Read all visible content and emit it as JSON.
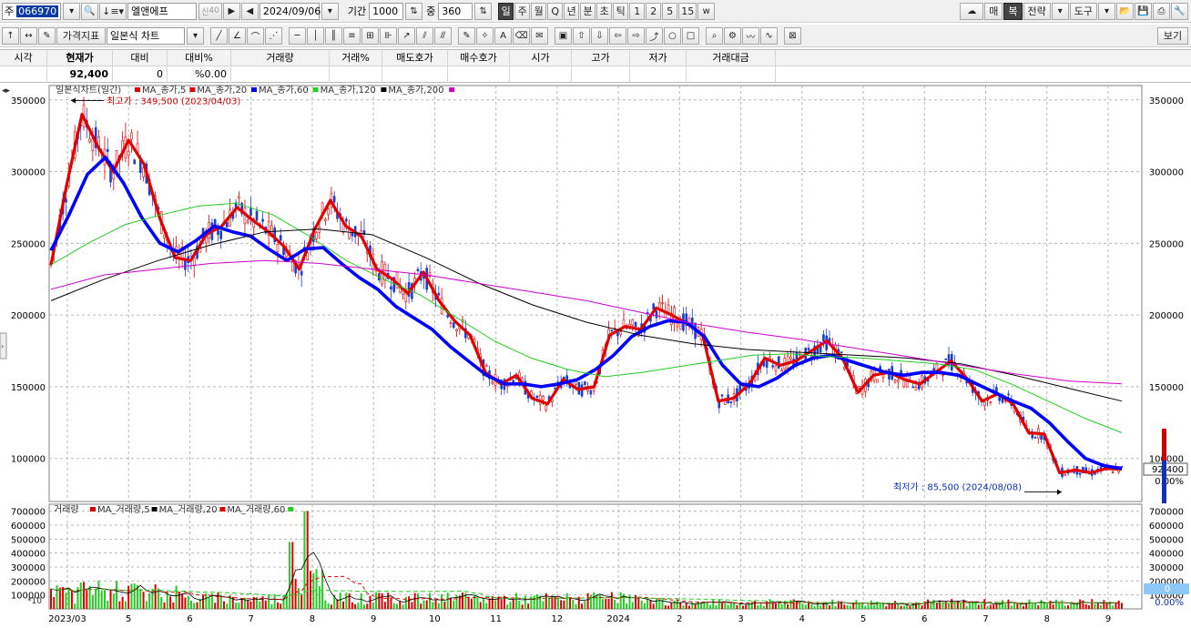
{
  "toolbar1": {
    "code_prefix": "주",
    "code": "066970",
    "stock_name": "엘앤에프",
    "badge_credit": "신",
    "badge_pct": "40",
    "date": "2024/09/06",
    "period_label": "기간",
    "period_value": "1000",
    "zoom_label": "중",
    "zoom_value": "360",
    "interval_buttons": [
      "일",
      "주",
      "월",
      "Q",
      "년",
      "분",
      "초",
      "틱",
      "1",
      "2",
      "5",
      "15"
    ],
    "right_buttons": [
      "매",
      "복",
      "전략",
      "도구"
    ]
  },
  "toolbar2": {
    "indicator_label": "가격지표",
    "chart_type": "일본식 차트",
    "view_button": "보기"
  },
  "quote": {
    "headers": [
      "시각",
      "현재가",
      "대비",
      "대비%",
      "거래량",
      "거래%",
      "매도호가",
      "매수호가",
      "시가",
      "고가",
      "저가",
      "거래대금"
    ],
    "values": [
      "",
      "92,400",
      "0",
      "%0.00",
      "",
      "",
      "",
      "",
      "",
      "",
      "",
      ""
    ]
  },
  "chart_data": [
    {
      "type": "candlestick",
      "title": "일본식차트(일간)",
      "legend": [
        {
          "name": "MA_종가,5",
          "color": "#e00000"
        },
        {
          "name": "MA_종가,20",
          "color": "#e00000"
        },
        {
          "name": "MA_종가,60",
          "color": "#0000ff"
        },
        {
          "name": "MA_종가,120",
          "color": "#22cc22"
        },
        {
          "name": "MA_종가,200",
          "color": "#000000"
        },
        {
          "name": "",
          "color": "#cc00cc"
        }
      ],
      "ylim": [
        70000,
        360000
      ],
      "y_ticks": [
        100000,
        150000,
        200000,
        250000,
        300000,
        350000
      ],
      "y_tick_labels": [
        "100000",
        "150000",
        "200000",
        "250000",
        "300000",
        "350000"
      ],
      "grid": true,
      "current_price_label": "92,400",
      "current_change_label": "0.00%",
      "annotations": [
        {
          "text": "최고가 : 349,500 (2023/04/03)",
          "value": 349500,
          "date": "2023/04/03"
        },
        {
          "text": "최저가 : 85,500 (2024/08/08)",
          "value": 85500,
          "date": "2024/08/08"
        }
      ],
      "x_labels": [
        "2023/03",
        "5",
        "6",
        "7",
        "8",
        "9",
        "10",
        "11",
        "12",
        "2024",
        "2",
        "3",
        "4",
        "5",
        "6",
        "7",
        "8",
        "9"
      ],
      "ma_series": [
        {
          "name": "MA_종가,5",
          "color": "#e00000",
          "values": [
            235000,
            290000,
            340000,
            318000,
            300000,
            322000,
            305000,
            268000,
            240000,
            238000,
            256000,
            262000,
            275000,
            266000,
            258000,
            248000,
            232000,
            260000,
            280000,
            262000,
            255000,
            232000,
            225000,
            215000,
            230000,
            210000,
            196000,
            186000,
            160000,
            152000,
            158000,
            142000,
            138000,
            155000,
            148000,
            150000,
            186000,
            192000,
            190000,
            205000,
            200000,
            194000,
            186000,
            140000,
            142000,
            152000,
            170000,
            165000,
            168000,
            175000,
            182000,
            170000,
            146000,
            158000,
            160000,
            155000,
            152000,
            160000,
            168000,
            156000,
            140000,
            145000,
            138000,
            118000,
            117000,
            90000,
            92000,
            90000,
            93000,
            92400
          ]
        },
        {
          "name": "MA_종가,20",
          "color": "#0000ff",
          "values": [
            245000,
            270000,
            298000,
            310000,
            292000,
            268000,
            250000,
            244000,
            252000,
            262000,
            258000,
            255000,
            246000,
            238000,
            246000,
            247000,
            236000,
            226000,
            218000,
            206000,
            198000,
            190000,
            178000,
            168000,
            158000,
            152000,
            152000,
            150000,
            152000,
            155000,
            162000,
            172000,
            185000,
            192000,
            196000,
            195000,
            185000,
            165000,
            152000,
            150000,
            156000,
            165000,
            170000,
            172000,
            168000,
            164000,
            160000,
            158000,
            160000,
            160000,
            158000,
            152000,
            146000,
            140000,
            135000,
            125000,
            112000,
            100000,
            95000,
            93000
          ]
        },
        {
          "name": "MA_종가,120",
          "color": "#22cc22",
          "values": [
            235000,
            250000,
            263000,
            270000,
            276000,
            278000,
            270000,
            255000,
            238000,
            225000,
            214000,
            198000,
            182000,
            170000,
            162000,
            157000,
            160000,
            164000,
            168000,
            172000,
            173000,
            171000,
            170000,
            168000,
            166000,
            162000,
            152000,
            140000,
            128000,
            118000
          ]
        },
        {
          "name": "MA_종가,200",
          "color": "#000000",
          "values": [
            210000,
            225000,
            238000,
            249000,
            258000,
            260000,
            256000,
            240000,
            222000,
            207000,
            195000,
            186000,
            180000,
            176000,
            174000,
            172000,
            170000,
            166000,
            158000,
            149000,
            140000
          ]
        },
        {
          "name": "",
          "color": "#cc00cc",
          "values": [
            218000,
            228000,
            232000,
            236000,
            238000,
            236000,
            232000,
            228000,
            222000,
            216000,
            210000,
            202000,
            194000,
            188000,
            183000,
            177000,
            171000,
            165000,
            159000,
            154000,
            152000
          ]
        }
      ]
    },
    {
      "type": "bar",
      "title": "거래량",
      "legend": [
        {
          "name": "MA_거래량,5",
          "color": "#e00000"
        },
        {
          "name": "MA_거래량,20",
          "color": "#000000"
        },
        {
          "name": "MA_거래량,60",
          "color": "#e00000"
        },
        {
          "name": "",
          "color": "#22cc22"
        }
      ],
      "ylim": [
        0,
        750000
      ],
      "y_ticks": [
        100000,
        200000,
        300000,
        400000,
        500000,
        600000,
        700000
      ],
      "y_tick_labels": [
        "100000",
        "200000",
        "300000",
        "400000",
        "500000",
        "600000",
        "700000"
      ],
      "unit_label": "*10",
      "current_value_label": "0",
      "current_change_label": "0.00%"
    }
  ]
}
